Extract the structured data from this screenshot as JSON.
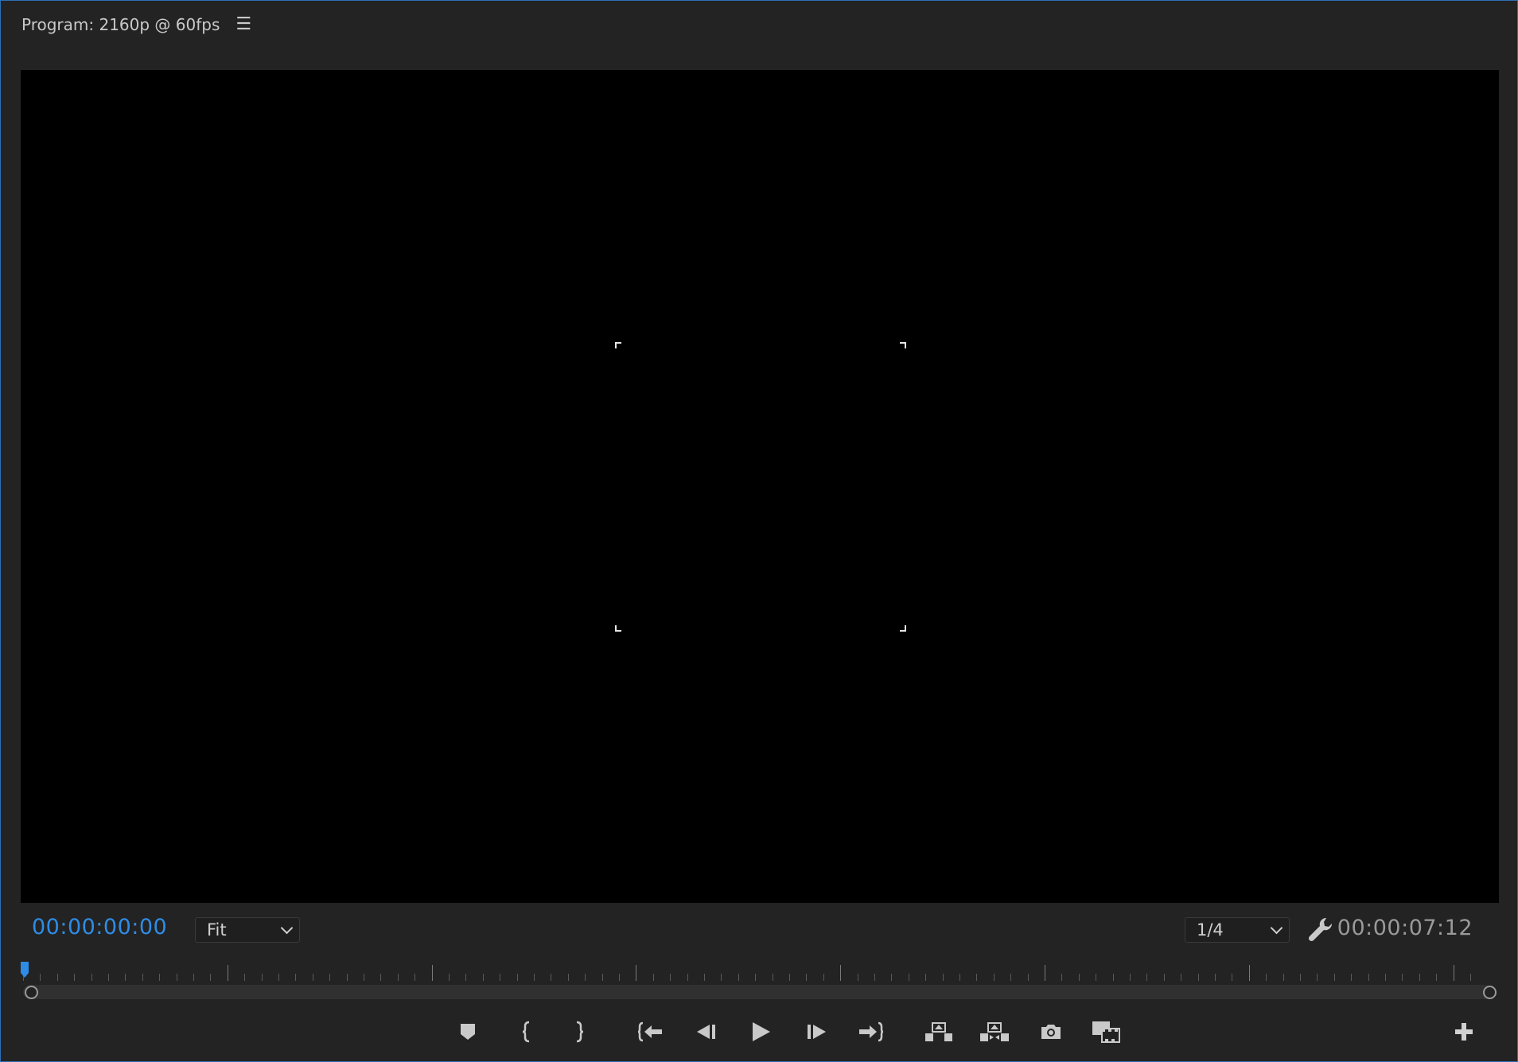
{
  "panel": {
    "title": "Program: 2160p @ 60fps",
    "menu_icon": "hamburger-menu-icon"
  },
  "timecode": {
    "current": "00:00:00:00",
    "duration": "00:00:07:12",
    "current_color": "#2e8ce6"
  },
  "zoom": {
    "selected": "Fit"
  },
  "resolution": {
    "selected": "1/4"
  },
  "controls": [
    {
      "name": "add-marker-button",
      "icon": "marker-icon"
    },
    {
      "name": "mark-in-button",
      "icon": "mark-in-icon"
    },
    {
      "name": "mark-out-button",
      "icon": "mark-out-icon"
    },
    {
      "name": "go-to-in-button",
      "icon": "go-to-in-icon"
    },
    {
      "name": "step-back-button",
      "icon": "step-back-icon"
    },
    {
      "name": "play-button",
      "icon": "play-icon"
    },
    {
      "name": "step-forward-button",
      "icon": "step-forward-icon"
    },
    {
      "name": "go-to-out-button",
      "icon": "go-to-out-icon"
    },
    {
      "name": "lift-button",
      "icon": "lift-icon"
    },
    {
      "name": "extract-button",
      "icon": "extract-icon"
    },
    {
      "name": "export-frame-button",
      "icon": "camera-icon"
    },
    {
      "name": "comparison-view-button",
      "icon": "comparison-view-icon"
    }
  ],
  "accent_color": "#2d6fb5"
}
